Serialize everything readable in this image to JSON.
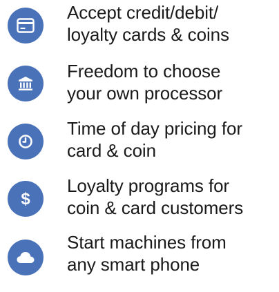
{
  "features": [
    {
      "icon": "credit-card-icon",
      "lines": [
        "Accept credit/debit/",
        "loyalty cards & coins"
      ]
    },
    {
      "icon": "bank-icon",
      "lines": [
        "Freedom to choose",
        "your own processor"
      ]
    },
    {
      "icon": "clock-icon",
      "lines": [
        "Time of day pricing for",
        "card & coin"
      ]
    },
    {
      "icon": "dollar-icon",
      "lines": [
        "Loyalty programs for",
        "coin & card customers"
      ]
    },
    {
      "icon": "cloud-icon",
      "lines": [
        "Start machines from",
        "any smart phone"
      ]
    }
  ],
  "colors": {
    "icon_background": "#4a72b8",
    "icon_glyph": "#ffffff",
    "text": "#1a1a1a"
  }
}
